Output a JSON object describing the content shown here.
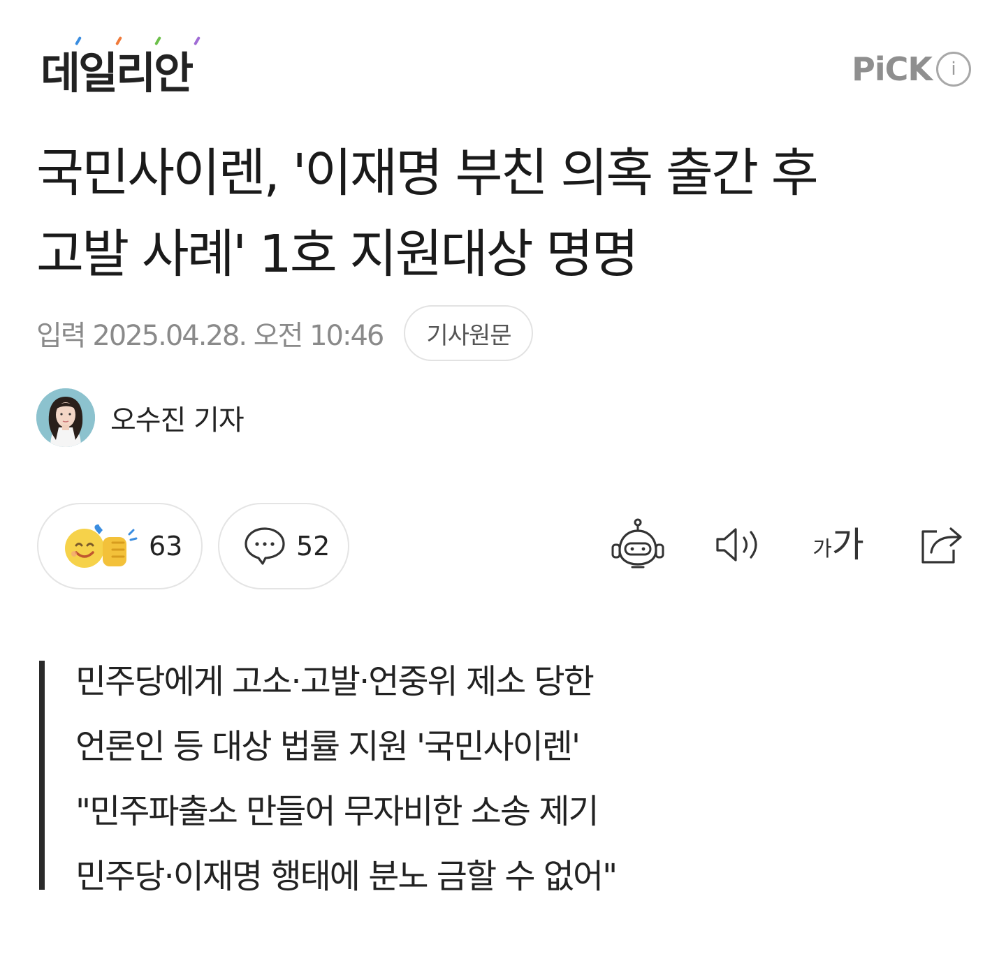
{
  "header": {
    "press_name": "데일리안",
    "logo_dot_colors": [
      "#3a8de0",
      "#f07a3a",
      "#6cc04a",
      "#a06cd5"
    ],
    "pick_label": "PiCK",
    "info_symbol": "i"
  },
  "article": {
    "title_line1": "국민사이렌, '이재명 부친 의혹 출간 후",
    "title_line2": "고발 사례' 1호 지원대상 명명",
    "date": "입력 2025.04.28. 오전 10:46",
    "origin_button": "기사원문",
    "reporter": "오수진 기자"
  },
  "reactions": {
    "like_count": "63",
    "comment_count": "52"
  },
  "tools": [
    {
      "icon": "robot-summary-icon"
    },
    {
      "icon": "speaker-icon"
    },
    {
      "icon": "font-size-icon",
      "small": "가",
      "big": "가"
    },
    {
      "icon": "share-icon"
    }
  ],
  "summary": [
    "민주당에게 고소·고발·언중위 제소 당한",
    "언론인 등 대상 법률 지원 '국민사이렌'",
    "\"민주파출소 만들어 무자비한 소송 제기",
    "민주당·이재명 행태에 분노 금할 수 없어\""
  ]
}
